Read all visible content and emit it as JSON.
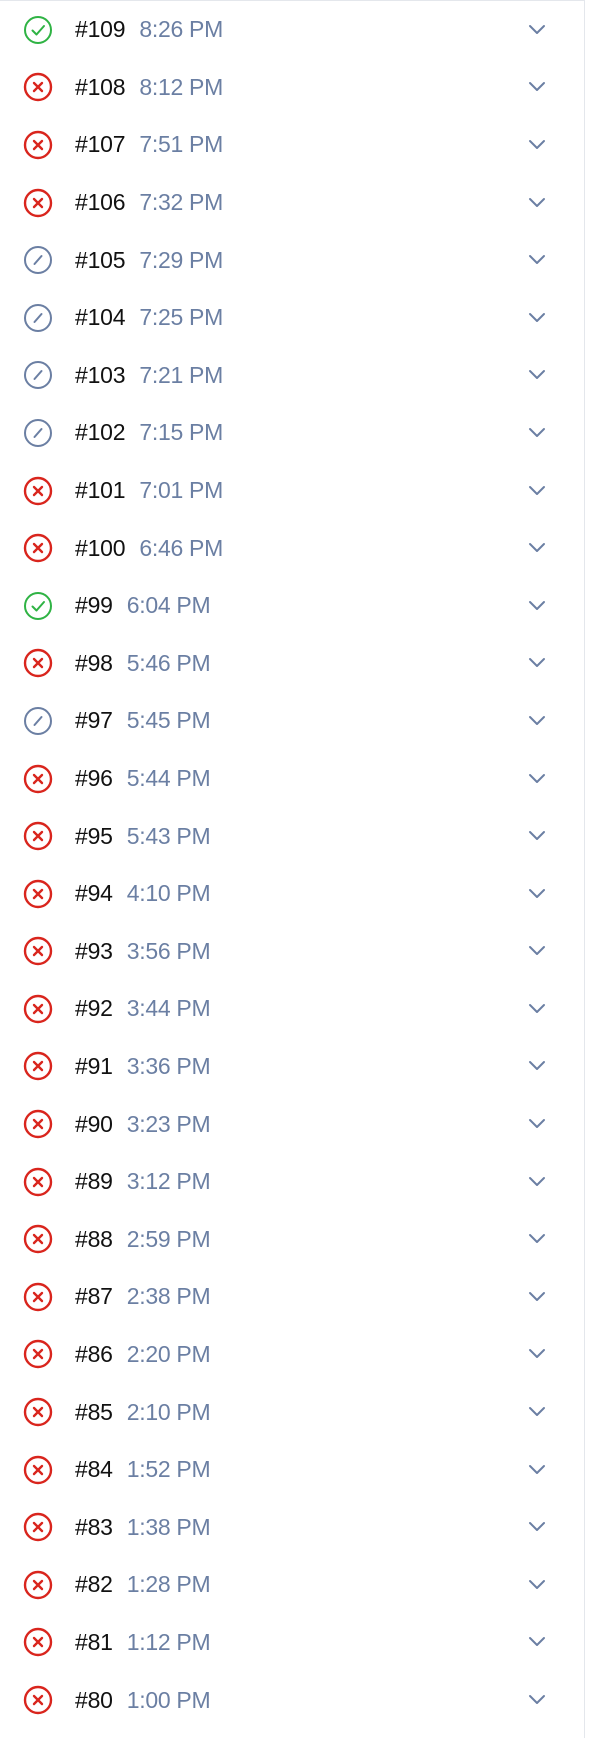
{
  "colors": {
    "success": "#2fb344",
    "failed": "#d9251d",
    "skipped": "#6b7fa3",
    "time_text": "#6b7fa3",
    "number_text": "#111111"
  },
  "icons": {
    "success": "check-circle-icon",
    "failed": "x-circle-icon",
    "skipped": "slash-circle-icon",
    "expand": "chevron-down-icon"
  },
  "builds": [
    {
      "number": "#109",
      "time": "8:26 PM",
      "status": "success"
    },
    {
      "number": "#108",
      "time": "8:12 PM",
      "status": "failed"
    },
    {
      "number": "#107",
      "time": "7:51 PM",
      "status": "failed"
    },
    {
      "number": "#106",
      "time": "7:32 PM",
      "status": "failed"
    },
    {
      "number": "#105",
      "time": "7:29 PM",
      "status": "skipped"
    },
    {
      "number": "#104",
      "time": "7:25 PM",
      "status": "skipped"
    },
    {
      "number": "#103",
      "time": "7:21 PM",
      "status": "skipped"
    },
    {
      "number": "#102",
      "time": "7:15 PM",
      "status": "skipped"
    },
    {
      "number": "#101",
      "time": "7:01 PM",
      "status": "failed"
    },
    {
      "number": "#100",
      "time": "6:46 PM",
      "status": "failed"
    },
    {
      "number": "#99",
      "time": "6:04 PM",
      "status": "success"
    },
    {
      "number": "#98",
      "time": "5:46 PM",
      "status": "failed"
    },
    {
      "number": "#97",
      "time": "5:45 PM",
      "status": "skipped"
    },
    {
      "number": "#96",
      "time": "5:44 PM",
      "status": "failed"
    },
    {
      "number": "#95",
      "time": "5:43 PM",
      "status": "failed"
    },
    {
      "number": "#94",
      "time": "4:10 PM",
      "status": "failed"
    },
    {
      "number": "#93",
      "time": "3:56 PM",
      "status": "failed"
    },
    {
      "number": "#92",
      "time": "3:44 PM",
      "status": "failed"
    },
    {
      "number": "#91",
      "time": "3:36 PM",
      "status": "failed"
    },
    {
      "number": "#90",
      "time": "3:23 PM",
      "status": "failed"
    },
    {
      "number": "#89",
      "time": "3:12 PM",
      "status": "failed"
    },
    {
      "number": "#88",
      "time": "2:59 PM",
      "status": "failed"
    },
    {
      "number": "#87",
      "time": "2:38 PM",
      "status": "failed"
    },
    {
      "number": "#86",
      "time": "2:20 PM",
      "status": "failed"
    },
    {
      "number": "#85",
      "time": "2:10 PM",
      "status": "failed"
    },
    {
      "number": "#84",
      "time": "1:52 PM",
      "status": "failed"
    },
    {
      "number": "#83",
      "time": "1:38 PM",
      "status": "failed"
    },
    {
      "number": "#82",
      "time": "1:28 PM",
      "status": "failed"
    },
    {
      "number": "#81",
      "time": "1:12 PM",
      "status": "failed"
    },
    {
      "number": "#80",
      "time": "1:00 PM",
      "status": "failed"
    }
  ]
}
